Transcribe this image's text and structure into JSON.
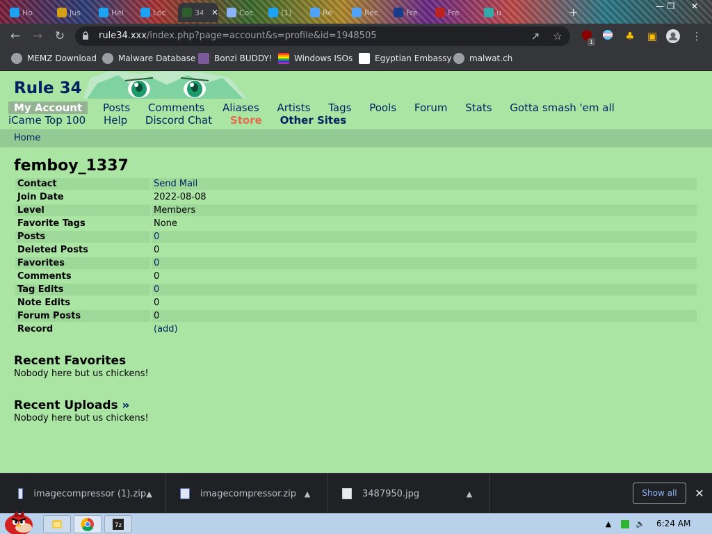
{
  "browser": {
    "tabs": [
      {
        "title": "Ho",
        "color": "#1da1f2"
      },
      {
        "title": "Jus",
        "color": "#d4a017"
      },
      {
        "title": "Hel",
        "color": "#1da1f2"
      },
      {
        "title": "Loc",
        "color": "#1da1f2"
      },
      {
        "title": "34",
        "color": "#2e5e2e"
      },
      {
        "title": "Coc",
        "color": "#8ab4f8"
      },
      {
        "title": "(1)",
        "color": "#1da1f2"
      },
      {
        "title": "Re",
        "color": "#4fa3f7"
      },
      {
        "title": "Rec",
        "color": "#4fa3f7"
      },
      {
        "title": "Fre",
        "color": "#1a3a8a"
      },
      {
        "title": "Fre",
        "color": "#b22"
      },
      {
        "title": "u",
        "color": "#3aa"
      }
    ],
    "active_tab_close": "✕",
    "new_tab": "+",
    "window_controls": {
      "minimize": "—",
      "maximize": "❐",
      "close": "✕"
    },
    "url_host": "rule34.xxx",
    "url_path": "/index.php?page=account&s=profile&id=1948505",
    "extension_badge": "1"
  },
  "bookmarks": [
    {
      "label": "MEMZ Download",
      "icon": "globe-icon",
      "color": "#9aa0a6"
    },
    {
      "label": "Malware Database",
      "icon": "globe-icon",
      "color": "#9aa0a6"
    },
    {
      "label": "Bonzi BUDDY!",
      "icon": "bonzi-icon",
      "color": "#7a5a9a"
    },
    {
      "label": "Windows ISOs",
      "icon": "rainbow-flag-icon",
      "color": "#e33"
    },
    {
      "label": "Egyptian Embassy",
      "icon": "wix-icon",
      "color": "#fff"
    },
    {
      "label": "malwat.ch",
      "icon": "globe-icon",
      "color": "#9aa0a6"
    }
  ],
  "site": {
    "title": "Rule 34",
    "nav": [
      {
        "label": "My Account",
        "kind": "current"
      },
      {
        "label": "Posts",
        "kind": "normal"
      },
      {
        "label": "Comments",
        "kind": "normal"
      },
      {
        "label": "Aliases",
        "kind": "normal"
      },
      {
        "label": "Artists",
        "kind": "normal"
      },
      {
        "label": "Tags",
        "kind": "normal"
      },
      {
        "label": "Pools",
        "kind": "normal"
      },
      {
        "label": "Forum",
        "kind": "normal"
      },
      {
        "label": "Stats",
        "kind": "normal"
      },
      {
        "label": "Gotta smash 'em all",
        "kind": "normal"
      },
      {
        "label": "iCame Top 100",
        "kind": "normal"
      },
      {
        "label": "Help",
        "kind": "normal"
      },
      {
        "label": "Discord Chat",
        "kind": "normal"
      },
      {
        "label": "Store",
        "kind": "store"
      },
      {
        "label": "Other Sites",
        "kind": "other"
      }
    ],
    "subnav": "Home"
  },
  "profile": {
    "username": "femboy_1337",
    "rows": [
      {
        "key": "Contact",
        "value": "Send Mail",
        "link": true
      },
      {
        "key": "Join Date",
        "value": "2022-08-08",
        "link": false
      },
      {
        "key": "Level",
        "value": "Members",
        "link": false
      },
      {
        "key": "Favorite Tags",
        "value": "None",
        "link": false
      },
      {
        "key": "Posts",
        "value": "0",
        "link": true
      },
      {
        "key": "Deleted Posts",
        "value": "0",
        "link": false
      },
      {
        "key": "Favorites",
        "value": "0",
        "link": true
      },
      {
        "key": "Comments",
        "value": "0",
        "link": false
      },
      {
        "key": "Tag Edits",
        "value": "0",
        "link": true
      },
      {
        "key": "Note Edits",
        "value": "0",
        "link": false
      },
      {
        "key": "Forum Posts",
        "value": "0",
        "link": false
      },
      {
        "key": "Record",
        "value": "(add)",
        "link": true
      }
    ],
    "recent_favorites": {
      "heading": "Recent Favorites",
      "text": "Nobody here but us chickens!"
    },
    "recent_uploads": {
      "heading": "Recent Uploads",
      "arrow": "»",
      "text": "Nobody here but us chickens!"
    }
  },
  "downloads": {
    "items": [
      {
        "name": "imagecompressor (1).zip",
        "type": "zip"
      },
      {
        "name": "imagecompressor.zip",
        "type": "zip"
      },
      {
        "name": "3487950.jpg",
        "type": "jpg"
      }
    ],
    "show_all": "Show all",
    "close": "✕"
  },
  "taskbar": {
    "clock": "6:24 AM",
    "apps": [
      "explorer-icon",
      "chrome-icon",
      "7zip-icon"
    ]
  }
}
